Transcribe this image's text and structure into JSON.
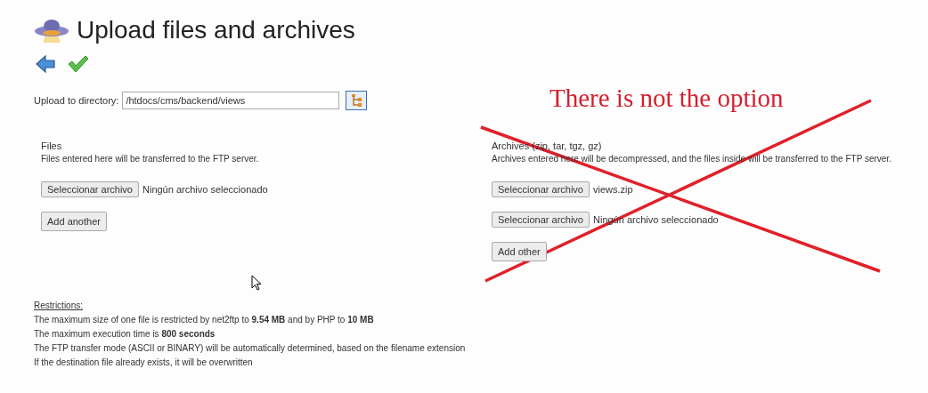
{
  "title": "Upload files and archives",
  "directory": {
    "label": "Upload to directory:",
    "value": "/htdocs/cms/backend/views"
  },
  "files": {
    "heading": "Files",
    "description": "Files entered here will be transferred to the FTP server.",
    "inputs": [
      {
        "button": "Seleccionar archivo",
        "filename": "Ningún archivo seleccionado"
      }
    ],
    "add_button": "Add another"
  },
  "archives": {
    "heading": "Archives (zip, tar, tgz, gz)",
    "description": "Archives entered here will be decompressed, and the files inside will be transferred to the FTP server.",
    "inputs": [
      {
        "button": "Seleccionar archivo",
        "filename": "views.zip"
      },
      {
        "button": "Seleccionar archivo",
        "filename": "Ningún archivo seleccionado"
      }
    ],
    "add_button": "Add other"
  },
  "restrictions": {
    "heading": "Restrictions:",
    "lines": [
      "The maximum size of one file is restricted by net2ftp to **9.54 MB** and by PHP to **10 MB**",
      "The maximum execution time is **800 seconds**",
      "The FTP transfer mode (ASCII or BINARY) will be automatically determined, based on the filename extension",
      "If the destination file already exists, it will be overwritten"
    ]
  },
  "annotation": {
    "text": "There is not the option"
  }
}
